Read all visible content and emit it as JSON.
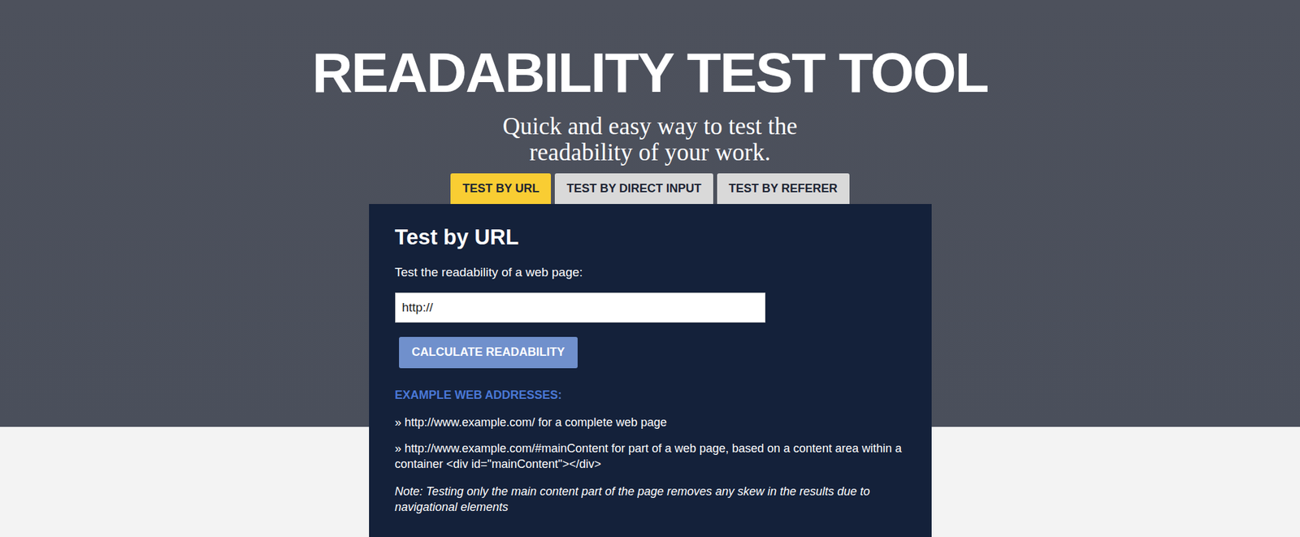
{
  "title": "READABILITY TEST TOOL",
  "subtitle_lines": [
    "Quick and easy way to test the",
    "readability of your work."
  ],
  "tabs": [
    {
      "label": "TEST BY URL",
      "selected": true
    },
    {
      "label": "TEST BY DIRECT INPUT",
      "selected": false
    },
    {
      "label": "TEST BY REFERER",
      "selected": false
    }
  ],
  "panel": {
    "heading": "Test by URL",
    "label": "Test the readability of a web page:",
    "input_value": "http://",
    "button": "CALCULATE READABILITY",
    "examples_heading": "EXAMPLE WEB ADDRESSES:",
    "examples": [
      "» http://www.example.com/ for a complete web page",
      "» http://www.example.com/#mainContent for part of a web page, based on a content area within a container <div id=\"mainContent\"></div>"
    ],
    "note": "Note: Testing only the main content part of the page removes any skew in the results due to navigational elements"
  }
}
